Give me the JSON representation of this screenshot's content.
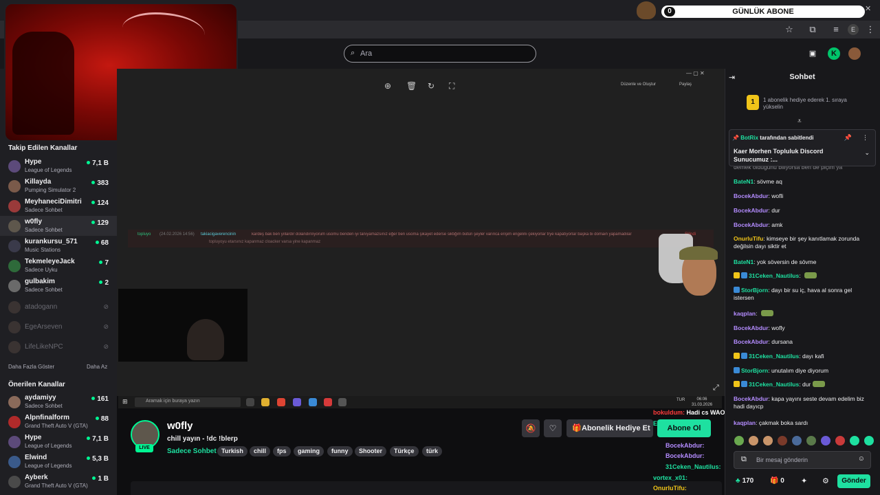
{
  "overlay": {
    "sub_counter_value": "0",
    "sub_counter_label": "GÜNLÜK ABONE"
  },
  "header": {
    "search_placeholder": "Ara"
  },
  "sidebar": {
    "followed_heading": "Takip Edilen Kanallar",
    "followed": [
      {
        "name": "Hype",
        "category": "League of Legends",
        "viewers": "7,1 B",
        "live": true
      },
      {
        "name": "Killayda",
        "category": "Pumping Simulator 2",
        "viewers": "383",
        "live": true
      },
      {
        "name": "MeyhaneciDimitri",
        "category": "Sadece Sohbet",
        "viewers": "124",
        "live": true
      },
      {
        "name": "w0fly",
        "category": "Sadece Sohbet",
        "viewers": "129",
        "live": true
      },
      {
        "name": "kurankursu_571",
        "category": "Music Stations",
        "viewers": "68",
        "live": true
      },
      {
        "name": "TekmeleyeJack",
        "category": "Sadece Uyku",
        "viewers": "7",
        "live": true
      },
      {
        "name": "gulbakim",
        "category": "Sadece Sohbet",
        "viewers": "2",
        "live": true
      },
      {
        "name": "atadogann",
        "category": "",
        "viewers": "",
        "live": false
      },
      {
        "name": "EgeArseven",
        "category": "",
        "viewers": "",
        "live": false
      },
      {
        "name": "LifeLikeNPC",
        "category": "",
        "viewers": "",
        "live": false
      }
    ],
    "show_more": "Daha Fazla Göster",
    "show_less": "Daha Az",
    "recommended_heading": "Önerilen Kanallar",
    "recommended": [
      {
        "name": "aydamiyy",
        "category": "Sadece Sohbet",
        "viewers": "161"
      },
      {
        "name": "Alpnfinalform",
        "category": "Grand Theft Auto V (GTA)",
        "viewers": "88"
      },
      {
        "name": "Hype",
        "category": "League of Legends",
        "viewers": "7,1 B"
      },
      {
        "name": "Elwind",
        "category": "League of Legends",
        "viewers": "5,3 B"
      },
      {
        "name": "Ayberk",
        "category": "Grand Theft Auto V (GTA)",
        "viewers": "1 B"
      }
    ]
  },
  "stream": {
    "toolbar_edit": "Düzenle ve Oluştur",
    "toolbar_share": "Paylaş",
    "taskbar_search": "Aramak için buraya yazın",
    "taskbar_clock": "06:06",
    "taskbar_date": "31.03.2026",
    "taskbar_lang": "TUR",
    "strip_user": "topluyo",
    "strip_time": "(24.02.2026 14:56)",
    "strip_user2": "takiacigaverencinin",
    "strip_text": "kardeş bak ben yıllardır dolandırılıyorum usomu benden iyi tanıyamazsınız eğer ben usoma şikayet ederse siktiğim bütün şeyler varınca erişim engelini çekiyorlar trye kapatıyorlar başka bi domain yapamadılar",
    "strip_text2": "topluyoyu etarsınız kapanmaz cloacker varsa yine kapanmaz",
    "strip_tag": "Silindi"
  },
  "channel": {
    "name": "w0fly",
    "live_label": "LIVE",
    "title": "chill yayın - !dc !blerp",
    "category": "Sadece Sohbet",
    "tags": [
      "Turkish",
      "chill",
      "fps",
      "gaming",
      "funny",
      "Shooter",
      "Türkçe",
      "türk"
    ],
    "gift_button": "Abonelik Hediye Et",
    "subscribe_button": "Abone Ol"
  },
  "overlay_chat": [
    {
      "user": "bokuldum:",
      "text": "Hadi cs WAOIEGOWJEQ",
      "color": "#ff3b3b"
    },
    {
      "user": "Egilroy:",
      "text": "",
      "color": "#1ee0a0"
    },
    {
      "user": "BocekAbdur:",
      "text": "",
      "color": "#b48cff"
    },
    {
      "user": "BocekAbdur:",
      "text": "",
      "color": "#b48cff"
    },
    {
      "user": "31Ceken_Nautilus:",
      "text": "",
      "color": "#1ee0a0"
    },
    {
      "user": "vortex_x01:",
      "text": "",
      "color": "#1ee0a0"
    },
    {
      "user": "OnurluTifu:",
      "text": "",
      "color": "#f0c419"
    }
  ],
  "chat": {
    "title": "Sohbet",
    "gift_banner_rank": "1",
    "gift_banner_text": "1 abonelik hediye ederek 1. sıraya yükselin",
    "pinned_by_user": "BotRix",
    "pinned_by_suffix": "tarafından sabitlendi",
    "pinned_message": "Kaer Morhen Topluluk Discord Sunucumuz :...",
    "partial_top": "demek olduğunu biliyorsa ben de piçim ya",
    "messages": [
      {
        "user": "BateN1",
        "text": "sövme aq",
        "color": "#1ee0a0",
        "badges": []
      },
      {
        "user": "BocekAbdur",
        "text": "wofli",
        "color": "#b48cff",
        "badges": []
      },
      {
        "user": "BocekAbdur",
        "text": "dur",
        "color": "#b48cff",
        "badges": []
      },
      {
        "user": "BocekAbdur",
        "text": "amk",
        "color": "#b48cff",
        "badges": []
      },
      {
        "user": "OnurluTifu",
        "text": "kimseye bir şey kanıtlamak zorunda değilsin dayı siktir et",
        "color": "#f0c419",
        "badges": []
      },
      {
        "user": "BateN1",
        "text": "yok söversin de sövme",
        "color": "#1ee0a0",
        "badges": []
      },
      {
        "user": "31Ceken_Nautilus",
        "text": "",
        "color": "#1ee0a0",
        "badges": [
          "crown",
          "prime"
        ],
        "emote": true
      },
      {
        "user": "StorBjorn",
        "text": "dayı bir su iç, hava al sonra gel istersen",
        "color": "#1ee0a0",
        "badges": [
          "prime"
        ]
      },
      {
        "user": "kaqplan",
        "text": "",
        "color": "#b48cff",
        "badges": [],
        "emote": true
      },
      {
        "user": "BocekAbdur",
        "text": "wofly",
        "color": "#b48cff",
        "badges": []
      },
      {
        "user": "BocekAbdur",
        "text": "dursana",
        "color": "#b48cff",
        "badges": []
      },
      {
        "user": "31Ceken_Nautilus",
        "text": "dayı kafi",
        "color": "#1ee0a0",
        "badges": [
          "crown",
          "prime"
        ]
      },
      {
        "user": "StorBjorn",
        "text": "unutalım diye diyorum",
        "color": "#1ee0a0",
        "badges": [
          "prime"
        ]
      },
      {
        "user": "31Ceken_Nautilus",
        "text": "dur",
        "color": "#1ee0a0",
        "badges": [
          "crown",
          "prime"
        ],
        "emote": true
      },
      {
        "user": "BocekAbdur",
        "text": "kapa yayını seste devam edelim biz hadi dayıcp",
        "color": "#b48cff",
        "badges": []
      },
      {
        "user": "kaqplan",
        "text": "çakmak boka sardı",
        "color": "#b48cff",
        "badges": []
      }
    ],
    "input_placeholder": "Bir mesaj gönderin",
    "points": "170",
    "gift_count": "0",
    "send_button": "Gönder"
  },
  "colors": {
    "accent": "#1ee0a0",
    "live_dot": "#00f593",
    "background": "#0e0e10",
    "panel": "#18181b"
  }
}
